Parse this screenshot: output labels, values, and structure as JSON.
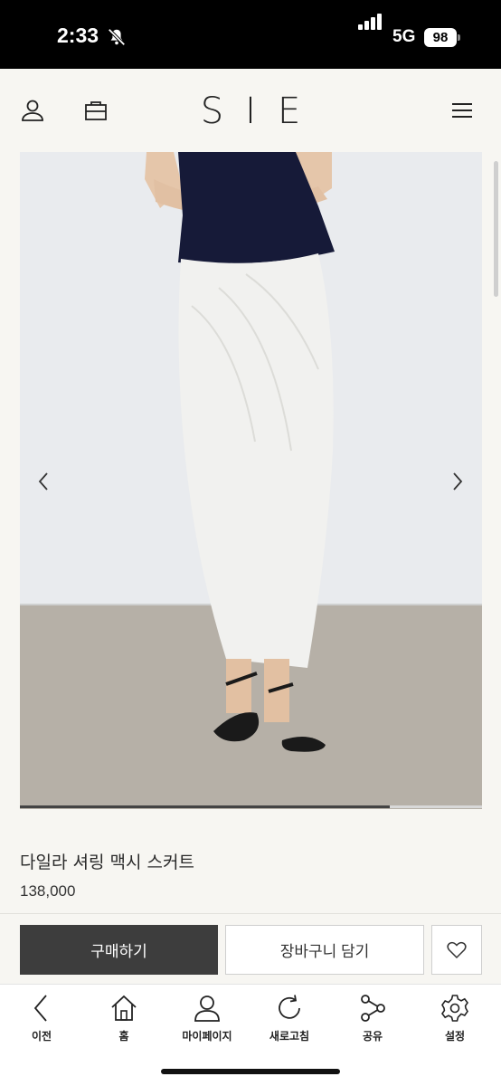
{
  "status_bar": {
    "time": "2:33",
    "network": "5G",
    "battery": "98",
    "icons": [
      "bell-slash-icon",
      "signal-icon"
    ]
  },
  "header": {
    "logo": "SIE",
    "icons": [
      "user-icon",
      "shopping-bag-icon",
      "menu-icon"
    ]
  },
  "gallery": {
    "progress": 0.8,
    "icons": [
      "chevron-left-icon",
      "chevron-right-icon"
    ],
    "colors": {
      "wall": "#e9ebee",
      "floor": "#b6b0a7",
      "top": "#161a38",
      "skirt": "#f1f1ef"
    }
  },
  "product": {
    "name": "다일라 셔링 맥시 스커트",
    "price": "138,000"
  },
  "actions": {
    "buy_label": "구매하기",
    "cart_label": "장바구니 담기",
    "wish_icon": "heart-icon"
  },
  "bottom_nav": {
    "items": [
      {
        "label": "이전",
        "icon": "back-icon"
      },
      {
        "label": "홈",
        "icon": "home-icon"
      },
      {
        "label": "마이페이지",
        "icon": "user-icon"
      },
      {
        "label": "새로고침",
        "icon": "refresh-icon"
      },
      {
        "label": "공유",
        "icon": "share-icon"
      },
      {
        "label": "설정",
        "icon": "gear-icon"
      }
    ]
  }
}
